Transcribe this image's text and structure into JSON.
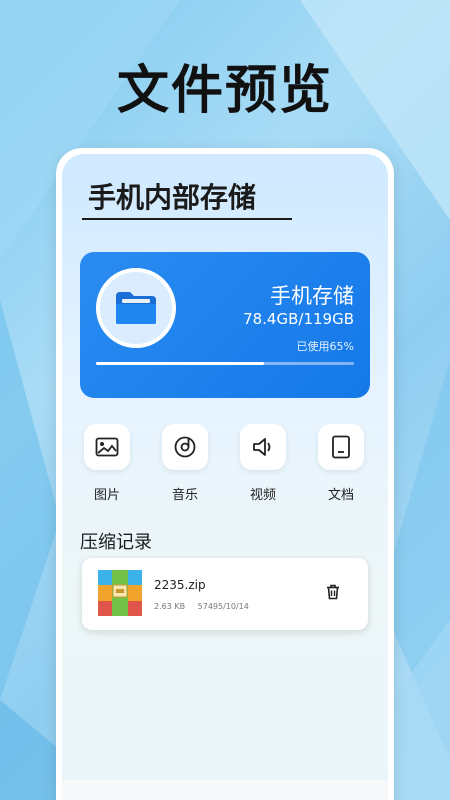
{
  "promo": {
    "title": "文件预览"
  },
  "header": {
    "title": "手机内部存储"
  },
  "storage": {
    "name": "手机存储",
    "size_text": "78.4GB/119GB",
    "used_text": "已使用65%",
    "used_fraction": 0.65
  },
  "categories": [
    {
      "label": "图片",
      "icon": "image-icon"
    },
    {
      "label": "音乐",
      "icon": "music-icon"
    },
    {
      "label": "视频",
      "icon": "video-icon"
    },
    {
      "label": "文档",
      "icon": "document-icon"
    }
  ],
  "history": {
    "title": "压缩记录",
    "items": [
      {
        "name": "2235.zip",
        "size": "2.63 KB",
        "date": "57495/10/14",
        "icon": "archive-icon",
        "action_icon": "trash-icon"
      }
    ]
  },
  "bottom_nav": {
    "items": [
      {
        "icon": "home-icon"
      },
      {
        "icon": "list-icon"
      },
      {
        "icon": "briefcase-icon"
      },
      {
        "icon": "profile-icon"
      }
    ]
  },
  "colors": {
    "accent": "#1a7fef",
    "background": "#9fd6f4"
  }
}
